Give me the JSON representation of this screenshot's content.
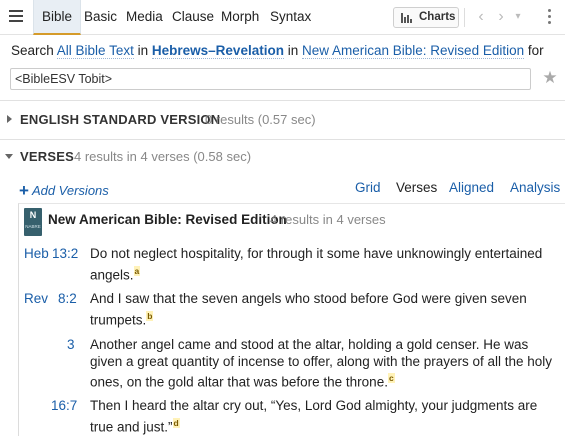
{
  "tabs": [
    "Bible",
    "Basic",
    "Media",
    "Clause",
    "Morph",
    "Syntax"
  ],
  "toolbar": {
    "charts_label": "Charts"
  },
  "search": {
    "prefix": "Search",
    "scope": "All Bible Text",
    "word_in": "in",
    "range": "Hebrews–Revelation",
    "word_in2": "in",
    "version": "New American Bible: Revised Edition",
    "word_for": "for",
    "query": "<BibleESV Tobit>"
  },
  "sections": [
    {
      "title": "ENGLISH STANDARD VERSION",
      "count": "0 results (0.57 sec)",
      "expanded": false
    },
    {
      "title": "VERSES",
      "count": "4 results in 4 verses (0.58 sec)",
      "expanded": true
    }
  ],
  "verse_actions": {
    "add_versions": "Add Versions",
    "view_tabs": [
      "Grid",
      "Verses",
      "Aligned",
      "Analysis"
    ],
    "current_view": "Verses"
  },
  "result": {
    "icon_letter": "N",
    "icon_caption": "NABRE",
    "title": "New American Bible: Revised Edition",
    "count": "4 results in 4 verses",
    "verses": [
      {
        "book": "Heb",
        "ref": "13:2",
        "text": "Do not neglect hospitality, for through it some have unknowingly entertained angels.",
        "note": "a"
      },
      {
        "book": "Rev",
        "ref": "8:2",
        "text": "And I saw that the seven angels who stood before God were given seven trumpets.",
        "note": "b"
      },
      {
        "book": "",
        "ref": "3",
        "text": "Another angel came and stood at the altar, holding a gold censer. He was given a great quantity of incense to offer, along with the prayers of all the holy ones, on the gold altar that was before the throne.",
        "note": "c"
      },
      {
        "book": "",
        "ref": "16:7",
        "text": "Then I heard the altar cry out, “Yes, Lord God almighty, your judgments are true and just.”",
        "note": "d"
      }
    ]
  },
  "colors": {
    "link": "#1a5ea8",
    "active_tab_underline": "#d59b2a",
    "book_icon": "#36606d"
  }
}
